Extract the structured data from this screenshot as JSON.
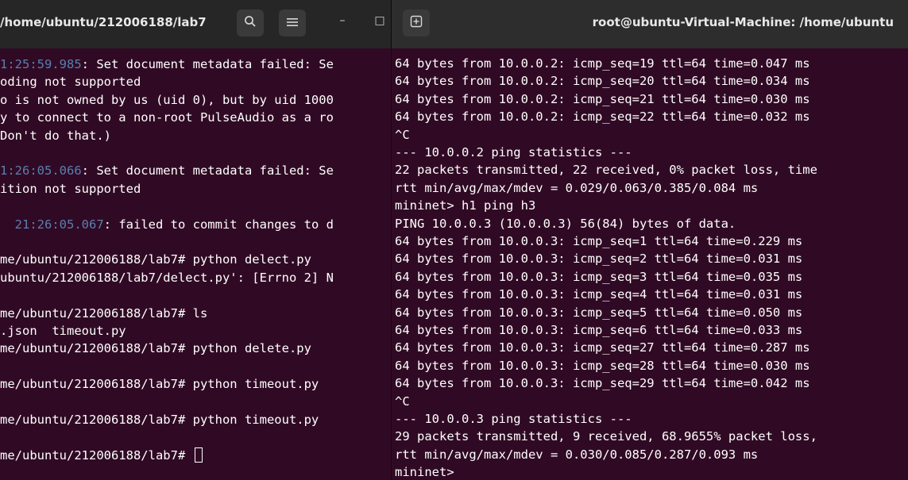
{
  "left_window": {
    "title": "/home/ubuntu/212006188/lab7",
    "controls": {
      "search": "search-icon",
      "menu": "hamburger-menu-icon",
      "minimize": "–",
      "maximize": "□"
    },
    "lines": [
      [
        {
          "cls": "ts",
          "t": "1:25:59.985"
        },
        {
          "t": ": Set document metadata failed: Se"
        }
      ],
      [
        {
          "t": "oding not supported"
        }
      ],
      [
        {
          "t": "o is not owned by us (uid 0), but by uid 1000"
        }
      ],
      [
        {
          "t": "y to connect to a non-root PulseAudio as a ro"
        }
      ],
      [
        {
          "t": "Don't do that.)"
        }
      ],
      [
        {
          "t": ""
        }
      ],
      [
        {
          "cls": "ts",
          "t": "1:26:05.066"
        },
        {
          "t": ": Set document metadata failed: Se"
        }
      ],
      [
        {
          "t": "ition not supported"
        }
      ],
      [
        {
          "t": ""
        }
      ],
      [
        {
          "cls": "ts",
          "t": "  21:26:05.067"
        },
        {
          "t": ": failed to commit changes to d"
        }
      ],
      [
        {
          "t": ""
        }
      ],
      [
        {
          "t": "me/ubuntu/212006188/lab7# python delect.py"
        }
      ],
      [
        {
          "t": "ubuntu/212006188/lab7/delect.py': [Errno 2] N"
        }
      ],
      [
        {
          "t": ""
        }
      ],
      [
        {
          "t": "me/ubuntu/212006188/lab7# ls"
        }
      ],
      [
        {
          "t": ".json  timeout.py"
        }
      ],
      [
        {
          "t": "me/ubuntu/212006188/lab7# python delete.py"
        }
      ],
      [
        {
          "t": ""
        }
      ],
      [
        {
          "t": "me/ubuntu/212006188/lab7# python timeout.py"
        }
      ],
      [
        {
          "t": ""
        }
      ],
      [
        {
          "t": "me/ubuntu/212006188/lab7# python timeout.py"
        }
      ],
      [
        {
          "t": ""
        }
      ],
      [
        {
          "t": "me/ubuntu/212006188/lab7# "
        },
        {
          "cls": "cursor",
          "t": ""
        }
      ]
    ]
  },
  "right_window": {
    "title": "root@ubuntu-Virtual-Machine: /home/ubuntu",
    "new_tab_icon": "new-tab-icon",
    "lines": [
      "64 bytes from 10.0.0.2: icmp_seq=19 ttl=64 time=0.047 ms",
      "64 bytes from 10.0.0.2: icmp_seq=20 ttl=64 time=0.034 ms",
      "64 bytes from 10.0.0.2: icmp_seq=21 ttl=64 time=0.030 ms",
      "64 bytes from 10.0.0.2: icmp_seq=22 ttl=64 time=0.032 ms",
      "^C",
      "--- 10.0.0.2 ping statistics ---",
      "22 packets transmitted, 22 received, 0% packet loss, time",
      "rtt min/avg/max/mdev = 0.029/0.063/0.385/0.084 ms",
      "mininet> h1 ping h3",
      "PING 10.0.0.3 (10.0.0.3) 56(84) bytes of data.",
      "64 bytes from 10.0.0.3: icmp_seq=1 ttl=64 time=0.229 ms",
      "64 bytes from 10.0.0.3: icmp_seq=2 ttl=64 time=0.031 ms",
      "64 bytes from 10.0.0.3: icmp_seq=3 ttl=64 time=0.035 ms",
      "64 bytes from 10.0.0.3: icmp_seq=4 ttl=64 time=0.031 ms",
      "64 bytes from 10.0.0.3: icmp_seq=5 ttl=64 time=0.050 ms",
      "64 bytes from 10.0.0.3: icmp_seq=6 ttl=64 time=0.033 ms",
      "64 bytes from 10.0.0.3: icmp_seq=27 ttl=64 time=0.287 ms",
      "64 bytes from 10.0.0.3: icmp_seq=28 ttl=64 time=0.030 ms",
      "64 bytes from 10.0.0.3: icmp_seq=29 ttl=64 time=0.042 ms",
      "^C",
      "--- 10.0.0.3 ping statistics ---",
      "29 packets transmitted, 9 received, 68.9655% packet loss,",
      "rtt min/avg/max/mdev = 0.030/0.085/0.287/0.093 ms",
      "mininet>"
    ]
  },
  "colors": {
    "terminal_bg": "#300a24",
    "header_bg": "#2d2d2d",
    "timestamp": "#5a7fb0",
    "text": "#ffffff"
  }
}
